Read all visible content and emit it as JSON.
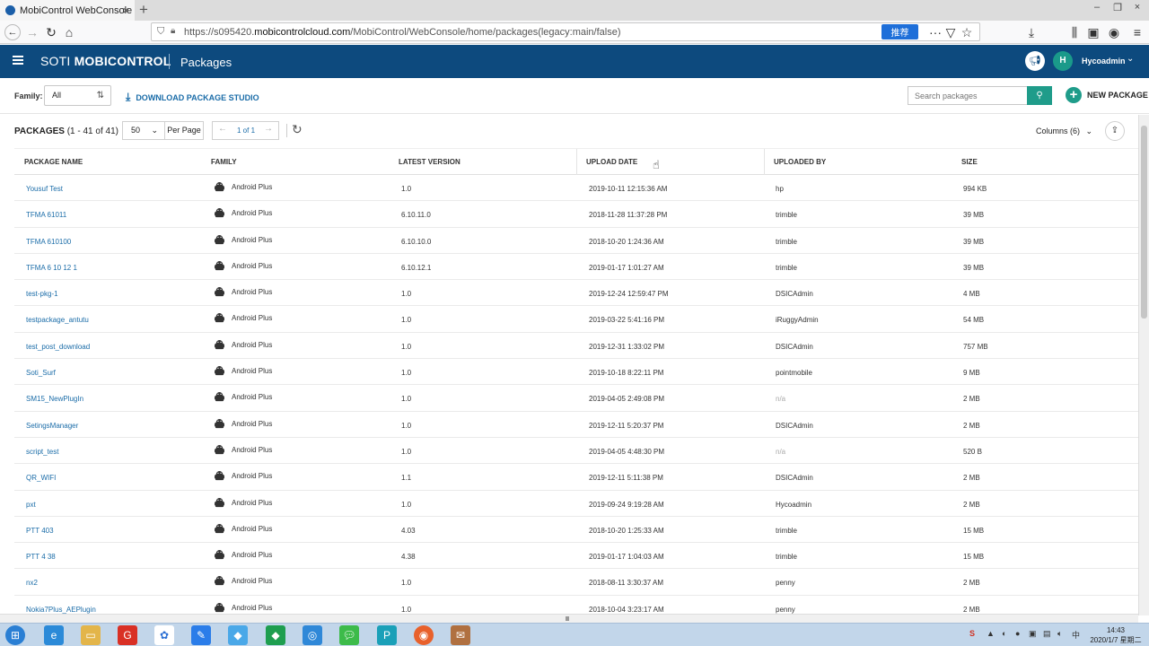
{
  "browser": {
    "tab_title": "MobiControl WebConsole",
    "url_prefix": "https://s095420.",
    "url_host": "mobicontrolcloud.com",
    "url_path": "/MobiControl/WebConsole/home/packages(legacy:main/false)",
    "url_badge": "推荐"
  },
  "header": {
    "brand_light": "SOTI ",
    "brand_bold": "MOBICONTROL",
    "section": "Packages",
    "avatar_initial": "H",
    "username": "Hycoadmin"
  },
  "toolbar": {
    "family_label": "Family:",
    "family_value": "All",
    "download_studio": "DOWNLOAD PACKAGE STUDIO",
    "search_placeholder": "Search packages",
    "new_package": "NEW PACKAGE"
  },
  "packages_bar": {
    "title": "PACKAGES",
    "count": "(1 - 41 of 41)",
    "per_page_value": "50",
    "per_page_label": "Per Page",
    "page_indicator": "1 of 1",
    "columns": "Columns (6)"
  },
  "table": {
    "headers": {
      "name": "PACKAGE NAME",
      "family": "FAMILY",
      "version": "LATEST VERSION",
      "date": "UPLOAD DATE",
      "by": "UPLOADED BY",
      "size": "SIZE"
    },
    "rows": [
      {
        "name": "Yousuf Test",
        "family": "Android Plus",
        "version": "1.0",
        "date": "2019-10-11 12:15:36 AM",
        "by": "hp",
        "size": "994 KB"
      },
      {
        "name": "TFMA 61011",
        "family": "Android Plus",
        "version": "6.10.11.0",
        "date": "2018-11-28 11:37:28 PM",
        "by": "trimble",
        "size": "39 MB"
      },
      {
        "name": "TFMA 610100",
        "family": "Android Plus",
        "version": "6.10.10.0",
        "date": "2018-10-20 1:24:36 AM",
        "by": "trimble",
        "size": "39 MB"
      },
      {
        "name": "TFMA 6 10 12 1",
        "family": "Android Plus",
        "version": "6.10.12.1",
        "date": "2019-01-17 1:01:27 AM",
        "by": "trimble",
        "size": "39 MB"
      },
      {
        "name": "test-pkg-1",
        "family": "Android Plus",
        "version": "1.0",
        "date": "2019-12-24 12:59:47 PM",
        "by": "DSICAdmin",
        "size": "4 MB"
      },
      {
        "name": "testpackage_antutu",
        "family": "Android Plus",
        "version": "1.0",
        "date": "2019-03-22 5:41:16 PM",
        "by": "iRuggyAdmin",
        "size": "54 MB"
      },
      {
        "name": "test_post_download",
        "family": "Android Plus",
        "version": "1.0",
        "date": "2019-12-31 1:33:02 PM",
        "by": "DSICAdmin",
        "size": "757 MB"
      },
      {
        "name": "Soti_Surf",
        "family": "Android Plus",
        "version": "1.0",
        "date": "2019-10-18 8:22:11 PM",
        "by": "pointmobile",
        "size": "9 MB"
      },
      {
        "name": "SM15_NewPlugIn",
        "family": "Android Plus",
        "version": "1.0",
        "date": "2019-04-05 2:49:08 PM",
        "by": "n/a",
        "size": "2 MB"
      },
      {
        "name": "SetingsManager",
        "family": "Android Plus",
        "version": "1.0",
        "date": "2019-12-11 5:20:37 PM",
        "by": "DSICAdmin",
        "size": "2 MB"
      },
      {
        "name": "script_test",
        "family": "Android Plus",
        "version": "1.0",
        "date": "2019-04-05 4:48:30 PM",
        "by": "n/a",
        "size": "520 B"
      },
      {
        "name": "QR_WIFI",
        "family": "Android Plus",
        "version": "1.1",
        "date": "2019-12-11 5:11:38 PM",
        "by": "DSICAdmin",
        "size": "2 MB"
      },
      {
        "name": "pxt",
        "family": "Android Plus",
        "version": "1.0",
        "date": "2019-09-24 9:19:28 AM",
        "by": "Hycoadmin",
        "size": "2 MB"
      },
      {
        "name": "PTT 403",
        "family": "Android Plus",
        "version": "4.03",
        "date": "2018-10-20 1:25:33 AM",
        "by": "trimble",
        "size": "15 MB"
      },
      {
        "name": "PTT 4 38",
        "family": "Android Plus",
        "version": "4.38",
        "date": "2019-01-17 1:04:03 AM",
        "by": "trimble",
        "size": "15 MB"
      },
      {
        "name": "nx2",
        "family": "Android Plus",
        "version": "1.0",
        "date": "2018-08-11 3:30:37 AM",
        "by": "penny",
        "size": "2 MB"
      },
      {
        "name": "Nokia7Plus_AEPlugin",
        "family": "Android Plus",
        "version": "1.0",
        "date": "2018-10-04 3:23:17 AM",
        "by": "penny",
        "size": "2 MB"
      }
    ]
  },
  "taskbar": {
    "time": "14:43",
    "date": "2020/1/7 星期二"
  },
  "colors": {
    "header_bg": "#0d4a7e",
    "accent_teal": "#1f9c8a",
    "link_blue": "#1a6ca8"
  }
}
